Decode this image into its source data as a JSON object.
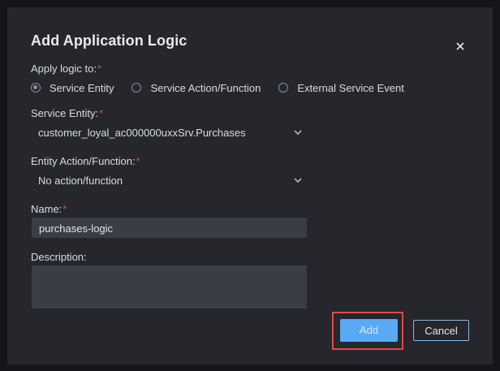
{
  "dialog": {
    "title": "Add Application Logic",
    "close_icon": "close-icon"
  },
  "apply_logic": {
    "label": "Apply logic to:",
    "required_mark": "*",
    "options": [
      {
        "label": "Service Entity",
        "checked": true
      },
      {
        "label": "Service Action/Function",
        "checked": false
      },
      {
        "label": "External Service Event",
        "checked": false
      }
    ]
  },
  "service_entity": {
    "label": "Service Entity:",
    "required_mark": "*",
    "value": "customer_loyal_ac000000uxxSrv.Purchases"
  },
  "entity_action": {
    "label": "Entity Action/Function:",
    "required_mark": "*",
    "value": "No action/function"
  },
  "name": {
    "label": "Name:",
    "required_mark": "*",
    "value": "purchases-logic"
  },
  "description": {
    "label": "Description:",
    "value": ""
  },
  "buttons": {
    "add_label": "Add",
    "cancel_label": "Cancel"
  },
  "colors": {
    "accent": "#5aa9f4",
    "required": "#e0463b",
    "highlight": "#e04a45",
    "dialog_bg": "#25272c"
  }
}
